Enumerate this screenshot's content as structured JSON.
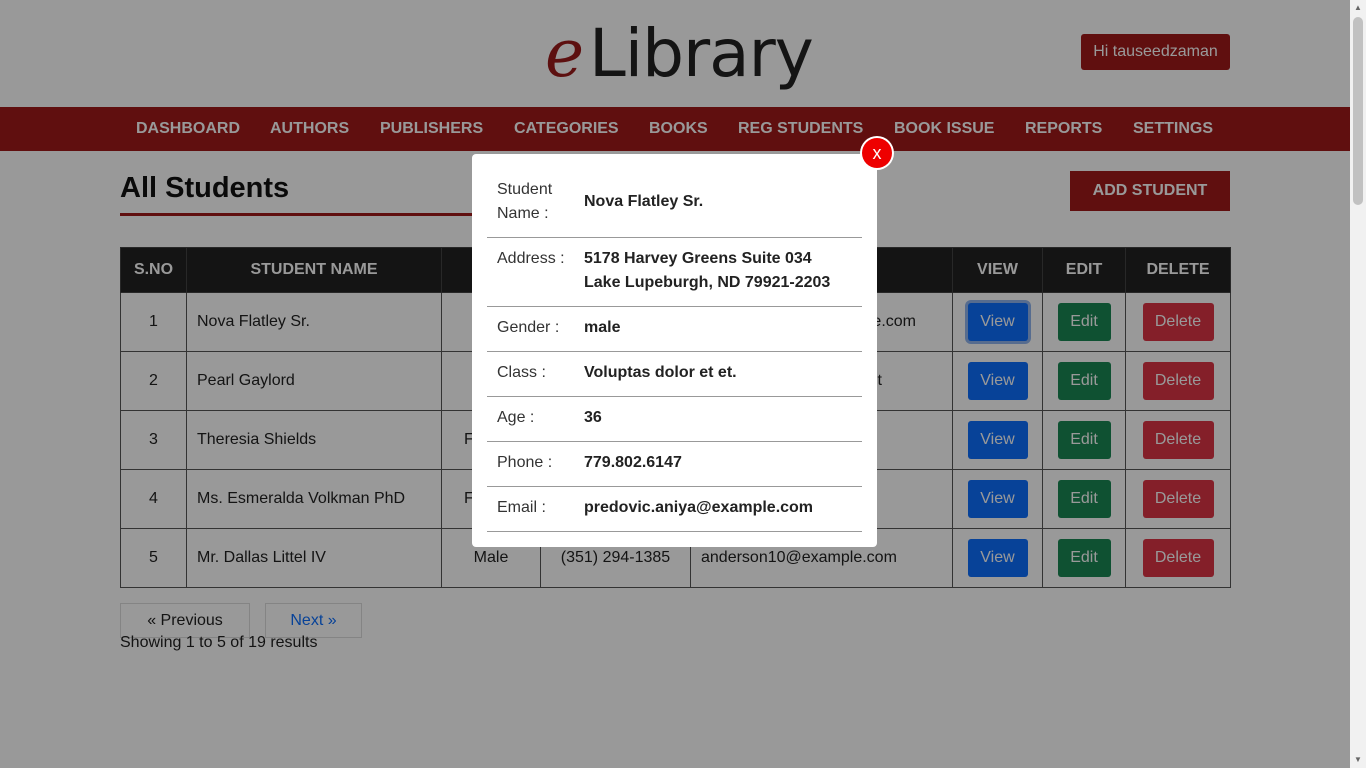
{
  "header": {
    "logo_e": "e",
    "logo_rest": "Library",
    "greeting": "Hi tauseedzaman"
  },
  "nav": {
    "items": [
      "DASHBOARD",
      "AUTHORS",
      "PUBLISHERS",
      "CATEGORIES",
      "BOOKS",
      "REG STUDENTS",
      "BOOK ISSUE",
      "REPORTS",
      "SETTINGS"
    ]
  },
  "main": {
    "title": "All Students",
    "add_button": "ADD STUDENT"
  },
  "table": {
    "headers": [
      "S.NO",
      "STUDENT NAME",
      "GE",
      "",
      "",
      "VIEW",
      "EDIT",
      "DELETE"
    ],
    "rows": [
      {
        "sno": "1",
        "name": "Nova Flatley Sr.",
        "gender": "",
        "phone": "",
        "email": "e.com"
      },
      {
        "sno": "2",
        "name": "Pearl Gaylord",
        "gender": "",
        "phone": "",
        "email": "t"
      },
      {
        "sno": "3",
        "name": "Theresia Shields",
        "gender": "F",
        "phone": "",
        "email": ""
      },
      {
        "sno": "4",
        "name": "Ms. Esmeralda Volkman PhD",
        "gender": "F",
        "phone": "",
        "email": ""
      },
      {
        "sno": "5",
        "name": "Mr. Dallas Littel IV",
        "gender": "Male",
        "phone": "(351) 294-1385",
        "email": "anderson10@example.com"
      }
    ],
    "view_label": "View",
    "edit_label": "Edit",
    "delete_label": "Delete"
  },
  "pagination": {
    "previous": "« Previous",
    "next": "Next »",
    "info": "Showing 1 to 5 of 19 results"
  },
  "modal": {
    "close_label": "x",
    "fields": [
      {
        "label": "Student Name :",
        "value": "Nova Flatley Sr."
      },
      {
        "label": "Address :",
        "value": "5178 Harvey Greens Suite 034 Lake Lupeburgh, ND 79921-2203"
      },
      {
        "label": "Gender :",
        "value": "male"
      },
      {
        "label": "Class :",
        "value": "Voluptas dolor et et."
      },
      {
        "label": "Age :",
        "value": "36"
      },
      {
        "label": "Phone :",
        "value": "779.802.6147"
      },
      {
        "label": "Email :",
        "value": "predovic.aniya@example.com"
      }
    ]
  },
  "colors": {
    "brand": "#a11a1a",
    "view": "#0d6efd",
    "edit": "#198754",
    "delete": "#dc3545",
    "close": "#ee0000"
  }
}
